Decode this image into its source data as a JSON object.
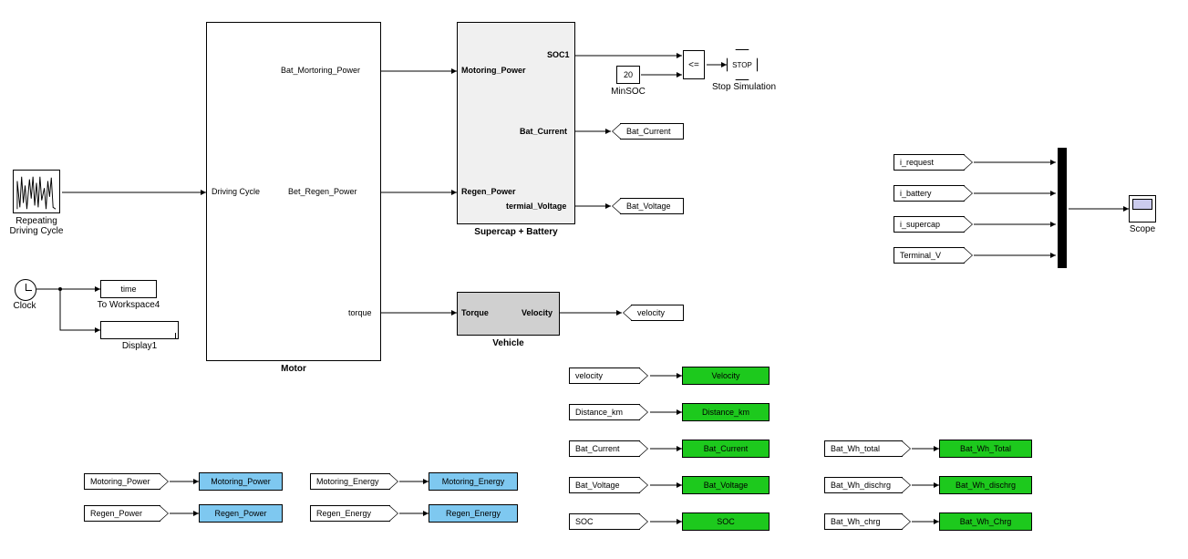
{
  "source": {
    "label": "Repeating\nDriving Cycle"
  },
  "clock": {
    "label": "Clock"
  },
  "to_ws_time": {
    "var": "time",
    "label": "To Workspace4"
  },
  "display1": {
    "label": "Display1"
  },
  "motor": {
    "title": "Motor",
    "in_driving": "Driving Cycle",
    "out_bat_motor": "Bat_Mortoring_Power",
    "out_bat_regen": "Bet_Regen_Power",
    "out_torque": "torque"
  },
  "supercap_battery": {
    "title": "Supercap + Battery",
    "in_motor": "Motoring_Power",
    "in_regen": "Regen_Power",
    "out_soc1": "SOC1",
    "out_bat_current": "Bat_Current",
    "out_term_v": "termial_Voltage"
  },
  "vehicle": {
    "title": "Vehicle",
    "in_torque": "Torque",
    "out_velocity": "Velocity"
  },
  "minsoc": {
    "value": "20",
    "label": "MinSOC"
  },
  "compare": {
    "op": "<="
  },
  "stop": {
    "text": "STOP",
    "label": "Stop Simulation"
  },
  "gotos": {
    "bat_current": "Bat_Current",
    "bat_voltage": "Bat_Voltage",
    "velocity": "velocity"
  },
  "scope_inputs": {
    "i_request": "i_request",
    "i_battery": "i_battery",
    "i_supercap": "i_supercap",
    "terminal_v": "Terminal_V",
    "scope_label": "Scope"
  },
  "bottom_pairs_blue": {
    "motoring_power": {
      "from": "Motoring_Power",
      "to": "Motoring_Power"
    },
    "regen_power": {
      "from": "Regen_Power",
      "to": "Regen_Power"
    },
    "motoring_energy": {
      "from": "Motoring_Energy",
      "to": "Motoring_Energy"
    },
    "regen_energy": {
      "from": "Regen_Energy",
      "to": "Regen_Energy"
    }
  },
  "bottom_pairs_green": {
    "velocity": {
      "from": "velocity",
      "to": "Velocity"
    },
    "distance": {
      "from": "Distance_km",
      "to": "Distance_km"
    },
    "bat_current": {
      "from": "Bat_Current",
      "to": "Bat_Current"
    },
    "bat_voltage": {
      "from": "Bat_Voltage",
      "to": "Bat_Voltage"
    },
    "soc": {
      "from": "SOC",
      "to": "SOC"
    },
    "bat_wh_total": {
      "from": "Bat_Wh_total",
      "to": "Bat_Wh_Total"
    },
    "bat_wh_dischrg": {
      "from": "Bat_Wh_dischrg",
      "to": "Bat_Wh_dischrg"
    },
    "bat_wh_chrg": {
      "from": "Bat_Wh_chrg",
      "to": "Bat_Wh_Chrg"
    }
  }
}
